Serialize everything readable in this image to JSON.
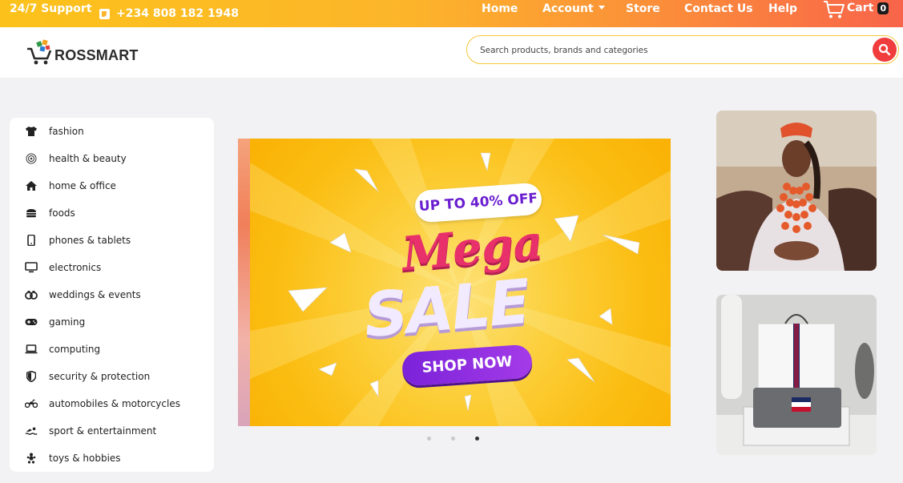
{
  "topbar": {
    "support": "24/7 Support",
    "phone": "+234 808 182 1948",
    "nav": {
      "home": "Home",
      "account": "Account",
      "store": "Store",
      "contact": "Contact Us",
      "help": "Help",
      "cart": "Cart",
      "cart_count": "0"
    }
  },
  "header": {
    "logo_text": "ROSSMART",
    "search_placeholder": "Search products, brands and categories"
  },
  "categories": [
    {
      "label": "fashion",
      "icon": "tshirt-icon"
    },
    {
      "label": "health & beauty",
      "icon": "beauty-icon"
    },
    {
      "label": "home & office",
      "icon": "home-icon"
    },
    {
      "label": "foods",
      "icon": "burger-icon"
    },
    {
      "label": "phones & tablets",
      "icon": "phone-icon"
    },
    {
      "label": "electronics",
      "icon": "monitor-icon"
    },
    {
      "label": "weddings & events",
      "icon": "wedding-icon"
    },
    {
      "label": "gaming",
      "icon": "gamepad-icon"
    },
    {
      "label": "computing",
      "icon": "laptop-icon"
    },
    {
      "label": "security & protection",
      "icon": "shield-icon"
    },
    {
      "label": "automobiles & motorcycles",
      "icon": "motorcycle-icon"
    },
    {
      "label": "sport & entertainment",
      "icon": "swimmer-icon"
    },
    {
      "label": "toys & hobbies",
      "icon": "toy-icon"
    }
  ],
  "banner": {
    "badge": "UP TO 40% OFF",
    "headline1": "Mega",
    "headline2": "SALE",
    "cta": "SHOP NOW",
    "slides_total": 3,
    "active_slide": 3
  },
  "colors": {
    "topbar_start": "#fcc21b",
    "topbar_end": "#f8644a",
    "search_border": "#f4c73a",
    "search_button": "#f03c3c",
    "banner_yellow": "#fbbd12",
    "mega_pink": "#e8306a",
    "cta_purple": "#7b22d9"
  }
}
